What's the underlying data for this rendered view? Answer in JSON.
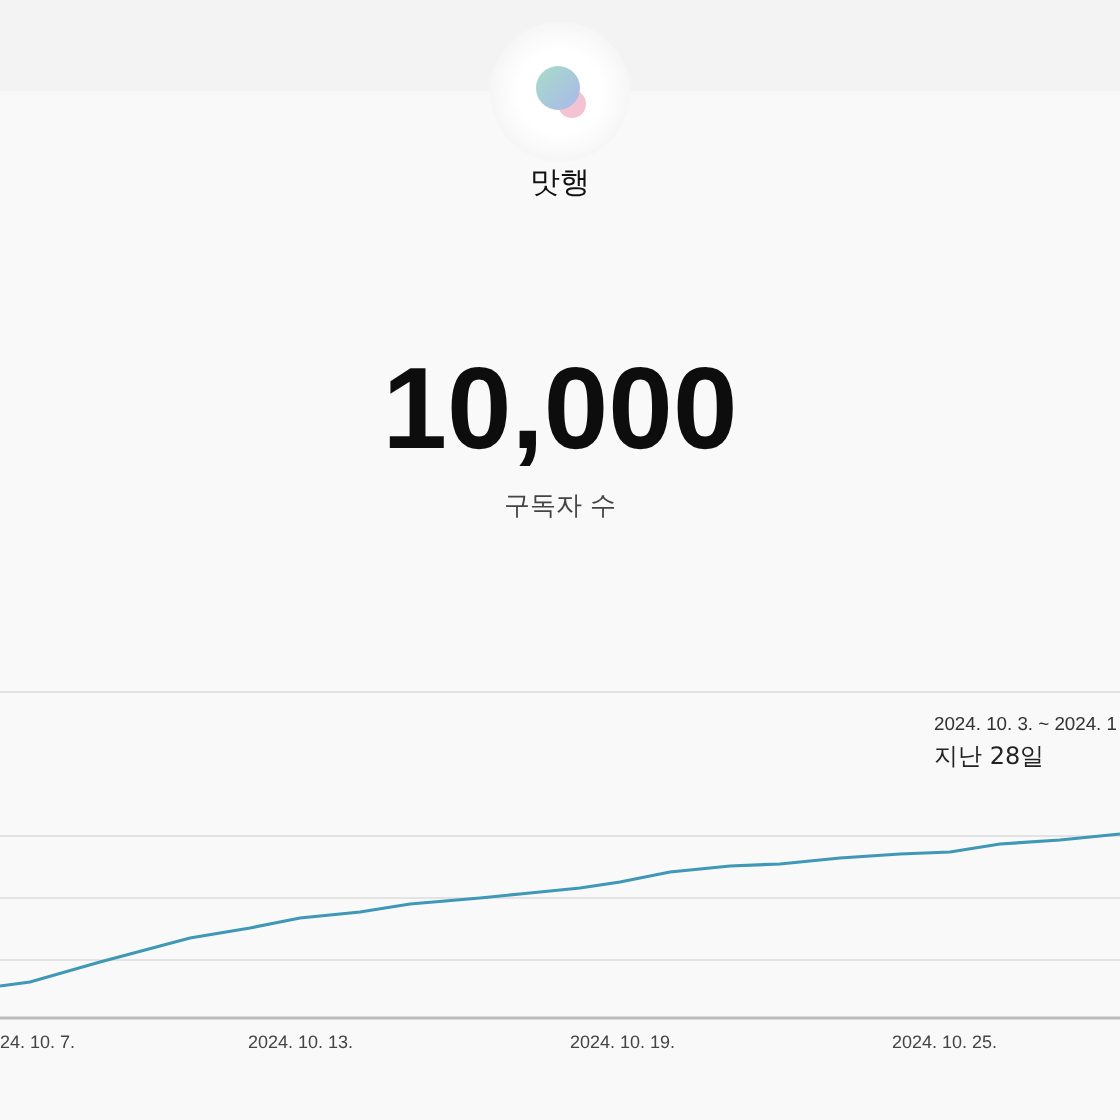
{
  "channel": {
    "name": "맛행"
  },
  "stat": {
    "value": "10,000",
    "label": "구독자 수"
  },
  "chart": {
    "range": "2024. 10. 3. ~ 2024. 1",
    "period": "지난 28일",
    "x_labels": [
      "24. 10. 7.",
      "2024. 10. 13.",
      "2024. 10. 19.",
      "2024. 10. 25."
    ]
  }
}
